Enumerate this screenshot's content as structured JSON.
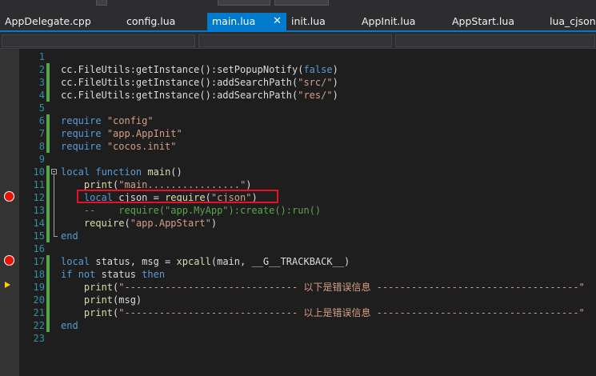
{
  "tabs": [
    {
      "label": "AppDelegate.cpp",
      "active": false
    },
    {
      "label": "config.lua",
      "active": false
    },
    {
      "label": "main.lua",
      "active": true
    },
    {
      "label": "init.lua",
      "active": false
    },
    {
      "label": "AppInit.lua",
      "active": false
    },
    {
      "label": "AppStart.lua",
      "active": false
    },
    {
      "label": "lua_cjson.c",
      "active": false
    }
  ],
  "tab_close_glyph": "✕",
  "line_numbers": [
    "1",
    "2",
    "3",
    "4",
    "5",
    "6",
    "7",
    "8",
    "9",
    "10",
    "11",
    "12",
    "13",
    "14",
    "15",
    "16",
    "17",
    "18",
    "19",
    "20",
    "21",
    "22",
    "23"
  ],
  "breakpoint_lines": [
    12,
    17
  ],
  "current_line": 19,
  "highlighted_line": 12,
  "code": {
    "line2": {
      "a": "cc.FileUtils:getInstance():setPopupNotify(",
      "b": "false",
      ")": ")"
    },
    "line3": {
      "a": "cc.FileUtils:getInstance():addSearchPath(",
      "b": "\"src/\"",
      "c": ")"
    },
    "line4": {
      "a": "cc.FileUtils:getInstance():addSearchPath(",
      "b": "\"res/\"",
      "c": ")"
    },
    "line6": {
      "kw": "require",
      "s": "\"config\""
    },
    "line7": {
      "kw": "require",
      "s": "\"app.AppInit\""
    },
    "line8": {
      "kw": "require",
      "s": "\"cocos.init\""
    },
    "line10": {
      "kw1": "local",
      "kw2": "function",
      "fn": "main",
      "rest": "()"
    },
    "line11": {
      "fn": "print",
      "p1": "(",
      "s": "\"main................\"",
      "p2": ")"
    },
    "line12": {
      "kw": "local",
      "mid": "cjson = ",
      "fn": "require",
      "p1": "(",
      "s": "\"cjson\"",
      "p2": ")"
    },
    "line13": {
      "comment": "--    require(\"app.MyApp\"):create():run()"
    },
    "line14": {
      "fn": "require",
      "p1": "(",
      "s": "\"app.AppStart\"",
      "p2": ")"
    },
    "line15": {
      "kw": "end"
    },
    "line17": {
      "kw": "local",
      "mid": "status, msg = ",
      "fn": "xpcall",
      "rest": "(main, __G__TRACKBACK__)"
    },
    "line18": {
      "kw1": "if",
      "kw2": "not",
      "mid": "status",
      "kw3": "then"
    },
    "line19": {
      "fn": "print",
      "p1": "(",
      "s": "\"------------------------------ 以下是错误信息 -----------------------------------\""
    },
    "line20": {
      "fn": "print",
      "rest": "(msg)"
    },
    "line21": {
      "fn": "print",
      "p1": "(",
      "s": "\"------------------------------ 以上是错误信息 -----------------------------------\""
    },
    "line22": {
      "kw": "end"
    }
  }
}
